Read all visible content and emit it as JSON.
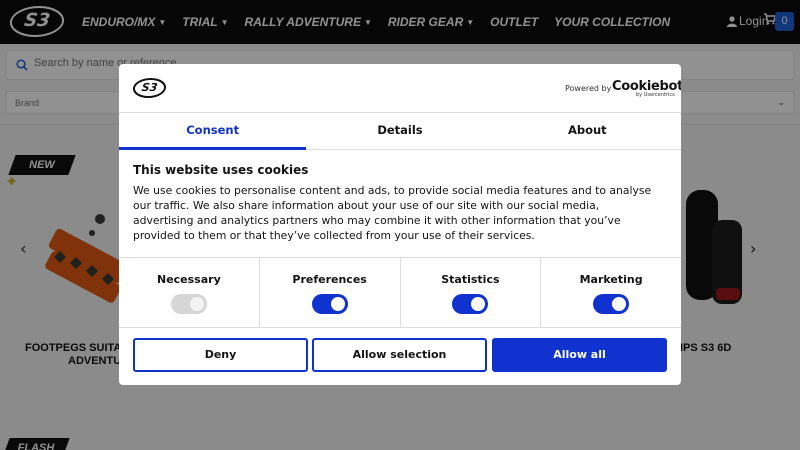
{
  "header": {
    "logo_text": "S3",
    "nav": [
      {
        "label": "ENDURO/MX",
        "dropdown": true
      },
      {
        "label": "TRIAL",
        "dropdown": true
      },
      {
        "label": "RALLY ADVENTURE",
        "dropdown": true
      },
      {
        "label": "RIDER GEAR",
        "dropdown": true
      },
      {
        "label": "OUTLET",
        "dropdown": false
      },
      {
        "label": "YOUR COLLECTION",
        "dropdown": false
      }
    ],
    "login_label": "Login",
    "cart_count": "0",
    "icons": {
      "login": "user-icon",
      "cart": "cart-icon",
      "search": "search-icon"
    }
  },
  "search": {
    "placeholder": "Search by name or reference"
  },
  "filters": {
    "brand_label": "Brand"
  },
  "products": {
    "badge_new": "NEW",
    "badge_flash": "FLASH",
    "items": [
      {
        "title_line1": "FOOTPEGS SUITABLE",
        "title_line2": "ADVENTURE"
      },
      {
        "title_line1": "IPS S3 6D",
        "title_line2": ""
      }
    ]
  },
  "consent": {
    "logo_text": "S3",
    "powered_by": "Powered by",
    "cookiebot": "Cookiebot",
    "cookiebot_sub": "by Usercentrics",
    "tabs": [
      "Consent",
      "Details",
      "About"
    ],
    "active_tab": "Consent",
    "heading": "This website uses cookies",
    "body": "We use cookies to personalise content and ads, to provide social media features and to analyse our traffic. We also share information about your use of our site with our social media, advertising and analytics partners who may combine it with other information that you’ve provided to them or that they’ve collected from your use of their services.",
    "categories": [
      {
        "label": "Necessary",
        "enabled": true,
        "locked": true
      },
      {
        "label": "Preferences",
        "enabled": true,
        "locked": false
      },
      {
        "label": "Statistics",
        "enabled": true,
        "locked": false
      },
      {
        "label": "Marketing",
        "enabled": true,
        "locked": false
      }
    ],
    "buttons": {
      "deny": "Deny",
      "allow_selection": "Allow selection",
      "allow_all": "Allow all"
    }
  },
  "colors": {
    "accent": "#1032cf",
    "header_bg": "#0b0b0b",
    "cart_badge": "#1f5fd6"
  }
}
